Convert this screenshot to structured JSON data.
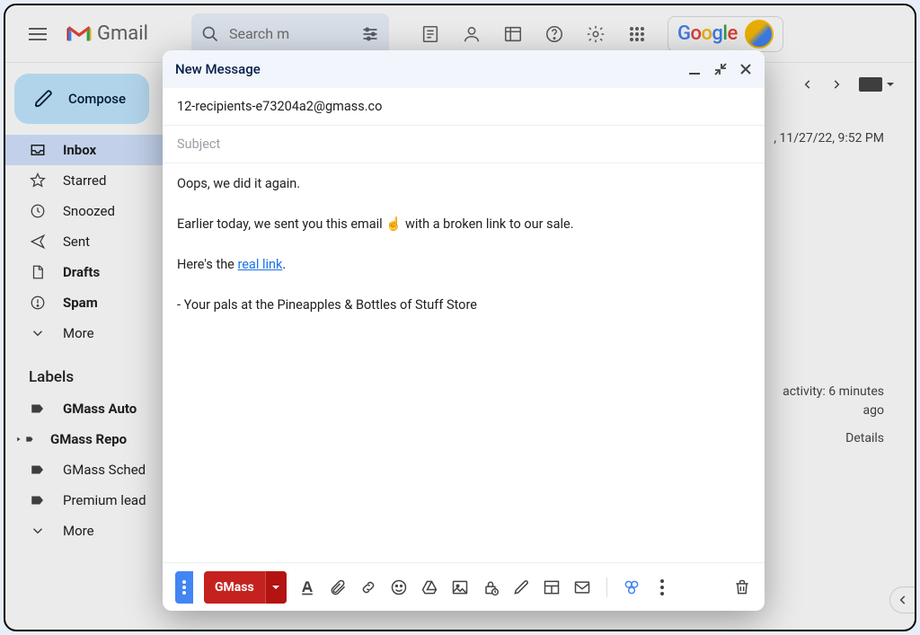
{
  "header": {
    "brand": "Gmail",
    "search_placeholder": "Search m",
    "google": "Google"
  },
  "compose_button": "Compose",
  "nav": {
    "inbox": "Inbox",
    "starred": "Starred",
    "snoozed": "Snoozed",
    "sent": "Sent",
    "drafts": "Drafts",
    "spam": "Spam",
    "more": "More"
  },
  "labels_heading": "Labels",
  "labels": {
    "auto": "GMass Auto",
    "repo": "GMass Repo",
    "sched": "GMass Sched",
    "prem": "Premium lead",
    "more": "More"
  },
  "right": {
    "timestamp": ", 11/27/22, 9:52 PM",
    "activity1": "activity: 6 minutes",
    "activity2": "ago",
    "details": "Details"
  },
  "compose_window": {
    "title": "New Message",
    "to": "12-recipients-e73204a2@gmass.co",
    "subject_placeholder": "Subject",
    "body": {
      "line1": "Oops, we did it again.",
      "line2a": "Earlier today, we sent you this email ",
      "line2_emoji": "☝️",
      "line2b": " with a broken link to our sale.",
      "line3a": "Here's the ",
      "link": "real link",
      "line3b": ".",
      "line4": "- Your pals at the Pineapples & Bottles of Stuff Store"
    },
    "gmass_label": "GMass"
  }
}
